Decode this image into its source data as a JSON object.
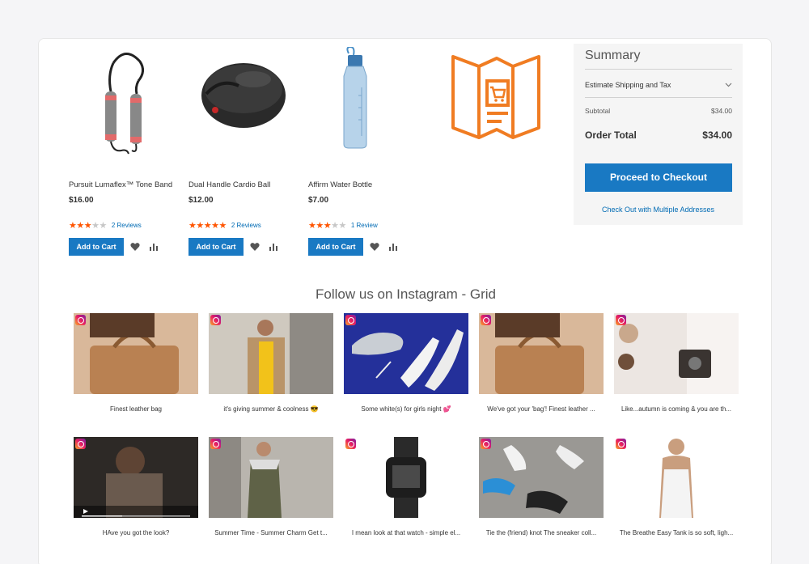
{
  "products": [
    {
      "name": "Pursuit Lumaflex™ Tone Band",
      "price": "$16.00",
      "stars": 3,
      "reviews": "2  Reviews",
      "add_label": "Add to Cart"
    },
    {
      "name": "Dual Handle Cardio Ball",
      "price": "$12.00",
      "stars": 5,
      "reviews": "2  Reviews",
      "add_label": "Add to Cart"
    },
    {
      "name": "Affirm Water Bottle",
      "price": "$7.00",
      "stars": 3,
      "reviews": "1  Review",
      "add_label": "Add to Cart"
    }
  ],
  "summary": {
    "title": "Summary",
    "estimate_label": "Estimate Shipping and Tax",
    "subtotal_label": "Subtotal",
    "subtotal_value": "$34.00",
    "total_label": "Order Total",
    "total_value": "$34.00",
    "checkout_label": "Proceed to Checkout",
    "multi_label": "Check Out with Multiple Addresses"
  },
  "instagram": {
    "title": "Follow us on Instagram - Grid",
    "captions": [
      "Finest leather bag",
      "it's giving summer & coolness 😎",
      "Some white(s) for girls night 💕",
      "We've got your 'bag'! Finest leather ...",
      "Like...autumn is coming & you are th...",
      "HAve you got the look?",
      "Summer Time - Summer Charm Get t...",
      "I mean look at that watch - simple el...",
      "Tie the (friend) knot The sneaker coll...",
      "The Breathe Easy Tank is so soft, ligh..."
    ]
  },
  "colors": {
    "accent": "#1979c3",
    "link": "#006bb4",
    "star": "#ff5501",
    "promo": "#f07c22"
  }
}
